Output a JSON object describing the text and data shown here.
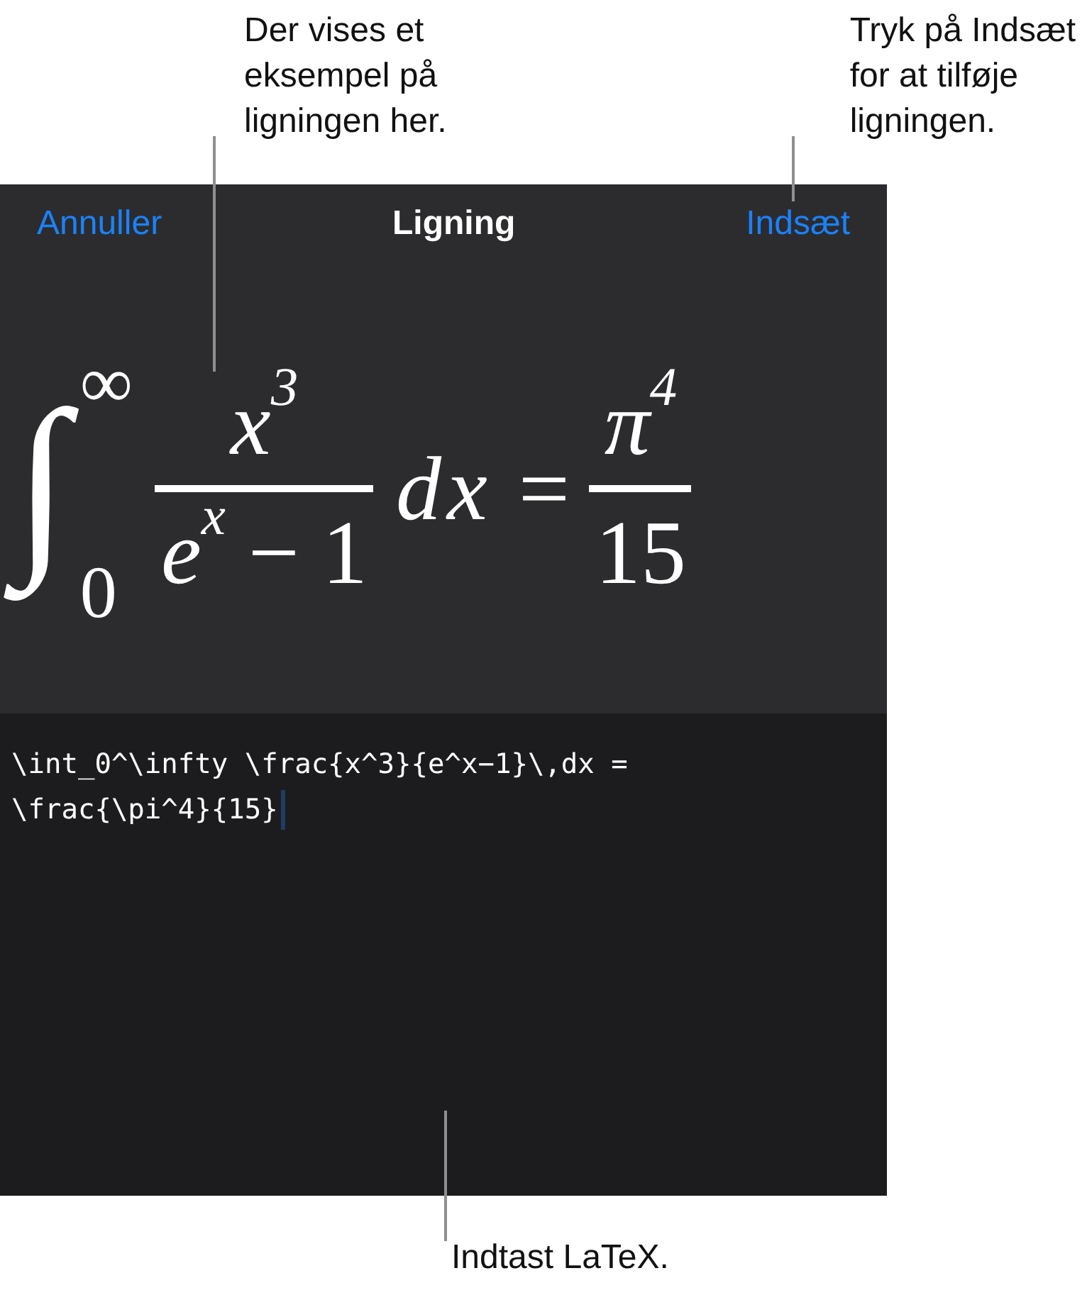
{
  "top_callouts": [
    {
      "lines": [
        "Der vises et",
        "eksempel på",
        "ligningen her."
      ]
    },
    {
      "lines": [
        "Tryk på Indsæt",
        "for at tilføje",
        "ligningen."
      ]
    }
  ],
  "bottom_callout": {
    "lines": [
      "Indtast LaTeX."
    ]
  },
  "nav": {
    "cancel": "Annuller",
    "title": "Ligning",
    "insert": "Indsæt"
  },
  "formula": {
    "integral": "∫",
    "upper": "∞",
    "lower": "0",
    "numerator": "*x*$^{3}$",
    "denominator": "*e*$^{x}$ − 1",
    "differential": "dx",
    "equals": "=",
    "rhs_numerator": "*π*$^{4}$",
    "rhs_denominator": "15"
  },
  "editor": {
    "lines": [
      "\\int_0^\\infty \\frac{x^3}{e^x−1}\\,dx =",
      "\\frac{\\pi^4}{15}"
    ],
    "focused": true
  }
}
